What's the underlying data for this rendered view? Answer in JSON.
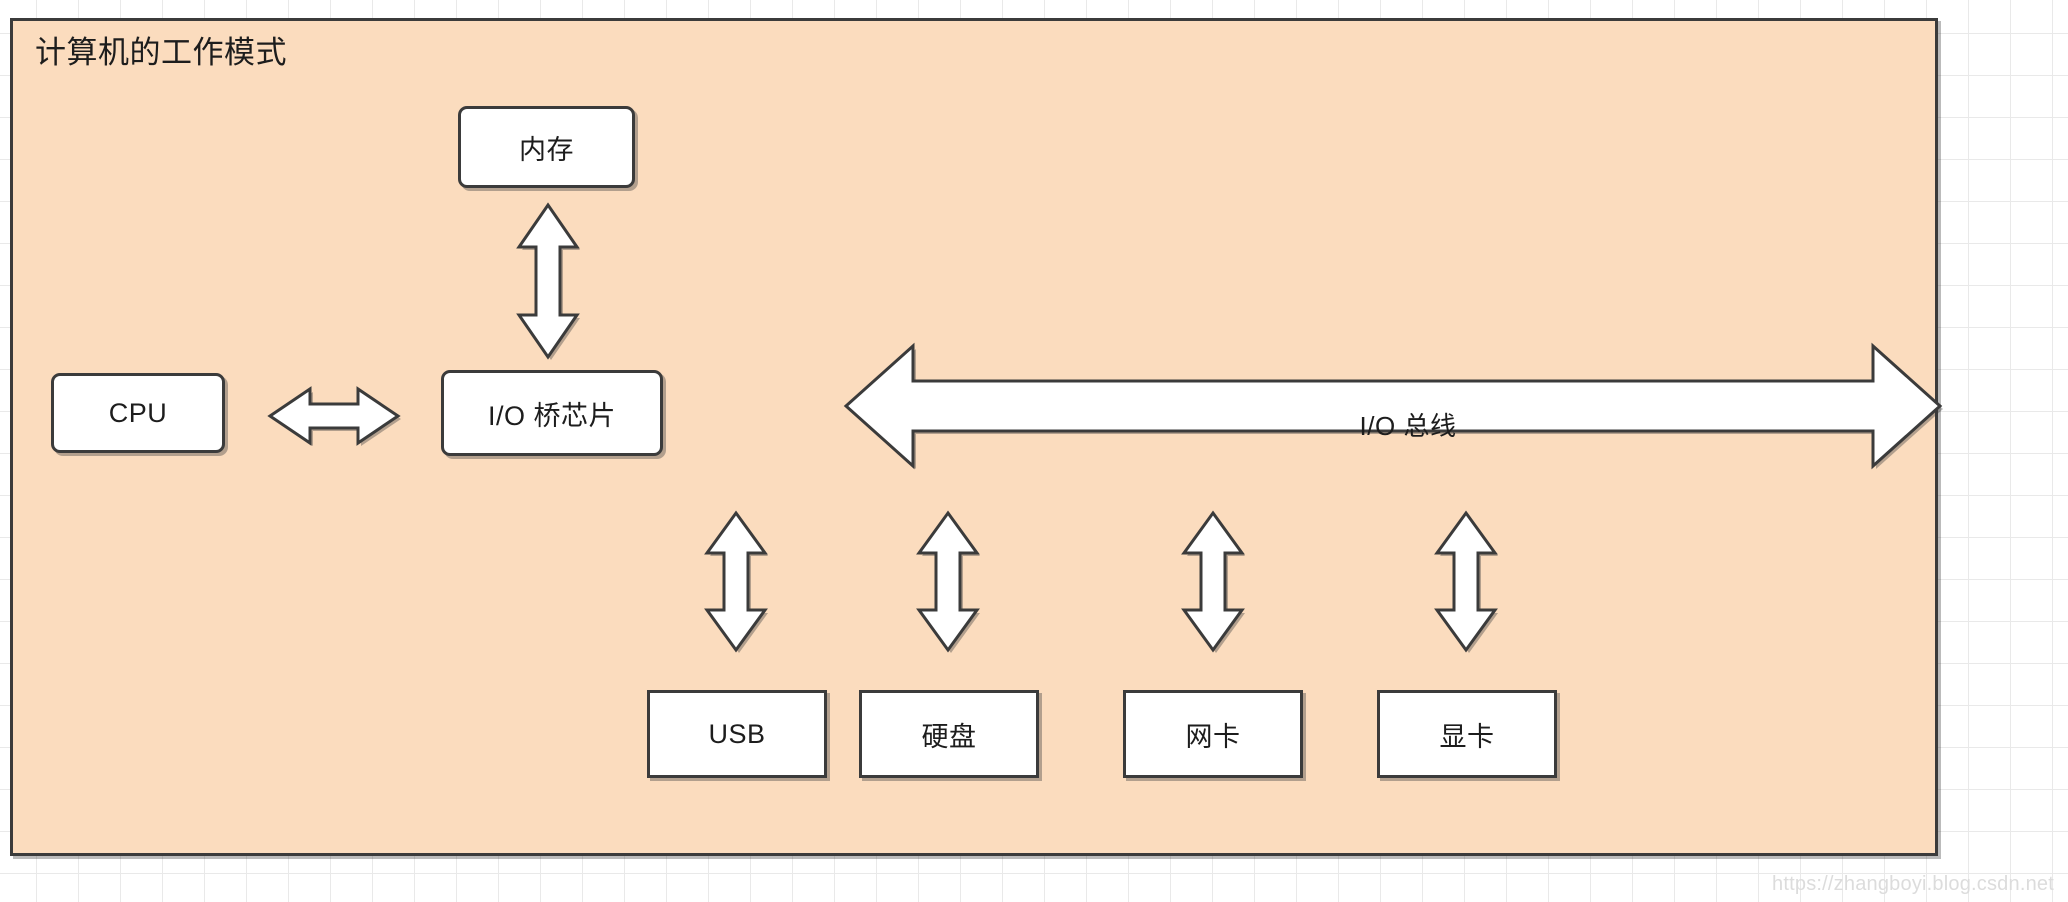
{
  "panel": {
    "title": "计算机的工作模式",
    "background_color": "#FBDCBE",
    "border_color": "#3b3b3b"
  },
  "nodes": {
    "memory": {
      "label": "内存"
    },
    "cpu": {
      "label": "CPU"
    },
    "io_bridge": {
      "label": "I/O 桥芯片"
    },
    "usb": {
      "label": "USB"
    },
    "hard_disk": {
      "label": "硬盘"
    },
    "network_card": {
      "label": "网卡"
    },
    "graphics_card": {
      "label": "显卡"
    }
  },
  "bus": {
    "label": "I/O 总线"
  },
  "connectors": {
    "memory_to_bridge": {
      "kind": "double-arrow-vertical"
    },
    "cpu_to_bridge": {
      "kind": "double-arrow-horizontal"
    },
    "bus_to_usb": {
      "kind": "double-arrow-vertical"
    },
    "bus_to_hard_disk": {
      "kind": "double-arrow-vertical"
    },
    "bus_to_network_card": {
      "kind": "double-arrow-vertical"
    },
    "bus_to_graphics_card": {
      "kind": "double-arrow-vertical"
    }
  },
  "watermark": {
    "text": "https://zhangboyi.blog.csdn.net"
  }
}
